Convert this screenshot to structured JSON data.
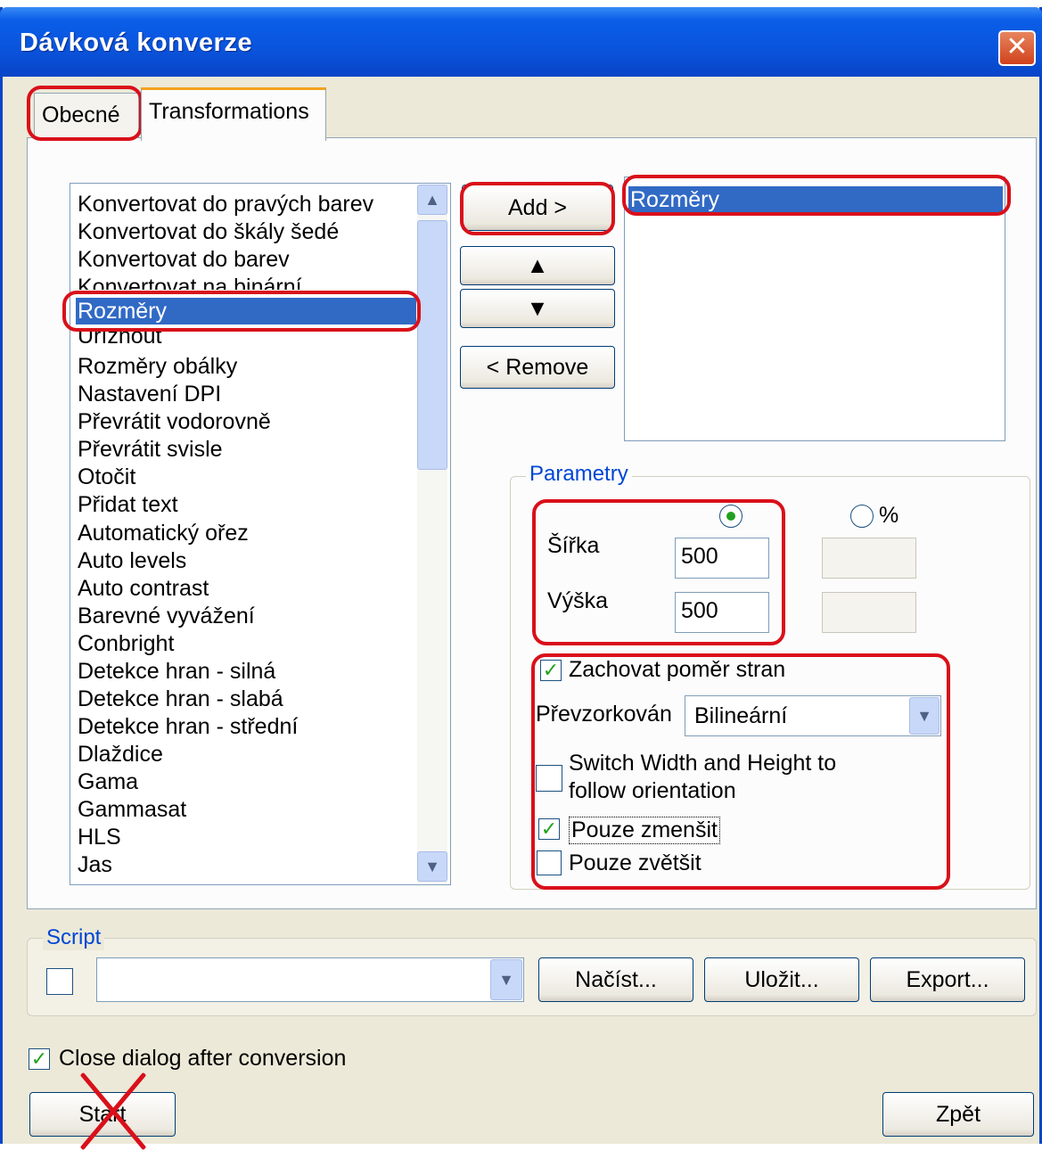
{
  "window": {
    "title": "Dávková konverze",
    "close_glyph": "✕"
  },
  "tabs": [
    {
      "label": "Obecné"
    },
    {
      "label": "Transformations"
    }
  ],
  "available_list": {
    "items": [
      "Konvertovat do pravých barev",
      "Konvertovat do škály šedé",
      "Konvertovat do barev",
      "Konvertovat na binární",
      "Rozměry",
      "Uříznout",
      "Rozměry obálky",
      "Nastavení DPI",
      "Převrátit vodorovně",
      "Převrátit svisle",
      "Otočit",
      "Přidat text",
      "Automatický ořez",
      "Auto levels",
      "Auto contrast",
      "Barevné vyvážení",
      "Conbright",
      "Detekce hran - silná",
      "Detekce hran - slabá",
      "Detekce hran - střední",
      "Dlaždice",
      "Gama",
      "Gammasat",
      "HLS",
      "Jas"
    ],
    "selected_index": 4
  },
  "buttons": {
    "add": "Add >",
    "move_up": "▲",
    "move_down": "▼",
    "remove": "< Remove",
    "load": "Načíst...",
    "save": "Uložit...",
    "export": "Export...",
    "start": "Start",
    "back": "Zpět"
  },
  "selected_list": {
    "items": [
      "Rozměry"
    ]
  },
  "parameters": {
    "legend": "Parametry",
    "percent_label": "%",
    "width_label": "Šířka",
    "width_value": "500",
    "height_label": "Výška",
    "height_value": "500",
    "keep_ratio_label": "Zachovat poměr stran",
    "keep_ratio_checked": true,
    "resample_label": "Převzorkován",
    "resample_value": "Bilineární",
    "switch_label_line1": "Switch Width and Height to",
    "switch_label_line2": "follow orientation",
    "switch_checked": false,
    "only_shrink_label": "Pouze zmenšit",
    "only_shrink_checked": true,
    "only_enlarge_label": "Pouze zvětšit",
    "only_enlarge_checked": false
  },
  "script": {
    "legend": "Script",
    "checked": false,
    "value": ""
  },
  "close_after": {
    "label": "Close dialog after conversion",
    "checked": true
  },
  "colors": {
    "title_bar": "#0a54dc",
    "selection": "#316ac5",
    "annotation_red": "#d9101a",
    "check_green": "#21a121"
  }
}
